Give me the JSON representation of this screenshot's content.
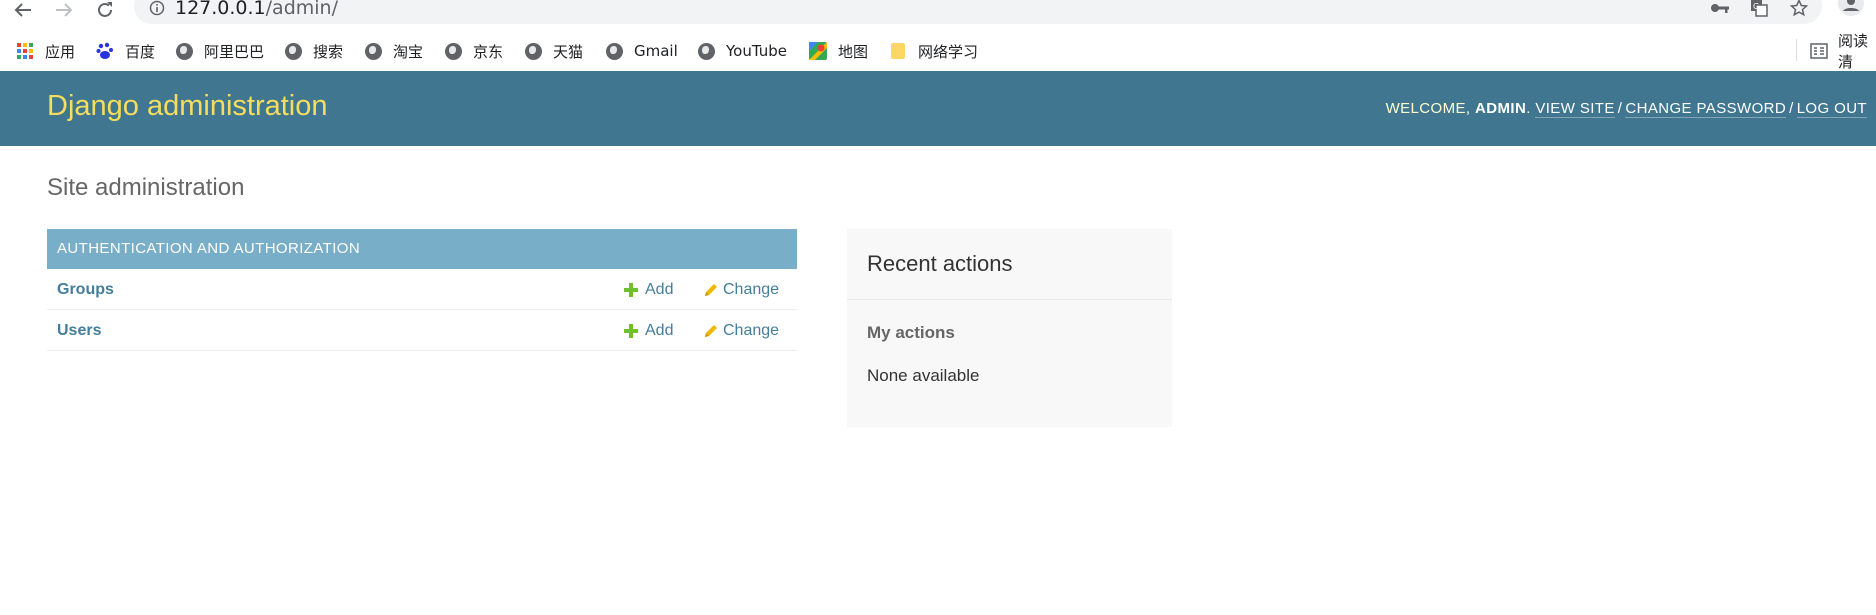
{
  "browser": {
    "url_host": "127.0.0.1",
    "url_path": "/admin/",
    "bookmarks": [
      {
        "label": "应用",
        "icon": "apps-grid-icon"
      },
      {
        "label": "百度",
        "icon": "baidu-paw-icon"
      },
      {
        "label": "阿里巴巴",
        "icon": "globe-icon"
      },
      {
        "label": "搜索",
        "icon": "globe-icon"
      },
      {
        "label": "淘宝",
        "icon": "globe-icon"
      },
      {
        "label": "京东",
        "icon": "globe-icon"
      },
      {
        "label": "天猫",
        "icon": "globe-icon"
      },
      {
        "label": "Gmail",
        "icon": "globe-icon"
      },
      {
        "label": "YouTube",
        "icon": "globe-icon"
      },
      {
        "label": "地图",
        "icon": "maps-icon"
      },
      {
        "label": "网络学习",
        "icon": "folder-icon"
      }
    ],
    "reading_list_label": "阅读清"
  },
  "header": {
    "branding": "Django administration",
    "welcome": "WELCOME, ",
    "username": "ADMIN",
    "view_site": "VIEW SITE",
    "change_password": "CHANGE PASSWORD",
    "log_out": "LOG OUT"
  },
  "content": {
    "title": "Site administration",
    "module": {
      "caption": "AUTHENTICATION AND AUTHORIZATION",
      "models": [
        {
          "name": "Groups",
          "add": "Add",
          "change": "Change"
        },
        {
          "name": "Users",
          "add": "Add",
          "change": "Change"
        }
      ]
    }
  },
  "recent_actions": {
    "title": "Recent actions",
    "subtitle": "My actions",
    "empty": "None available"
  },
  "colors": {
    "header_bg": "#417690",
    "branding": "#f5dd5d",
    "module_caption_bg": "#79aec8",
    "link": "#447e9b",
    "add_icon": "#70bf2b",
    "change_icon": "#efb80b"
  }
}
